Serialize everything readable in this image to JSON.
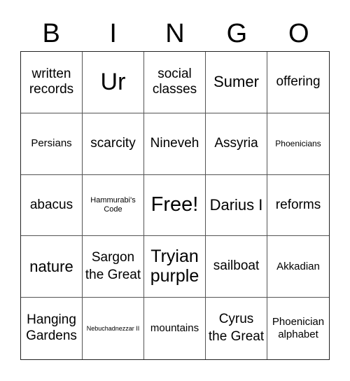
{
  "header": {
    "letters": [
      "B",
      "I",
      "N",
      "G",
      "O"
    ]
  },
  "grid": {
    "rows": [
      [
        "written records",
        "Ur",
        "social classes",
        "Sumer",
        "offering"
      ],
      [
        "Persians",
        "scarcity",
        "Nineveh",
        "Assyria",
        "Phoenicians"
      ],
      [
        "abacus",
        "Hammurabi's Code",
        "Free!",
        "Darius I",
        "reforms"
      ],
      [
        "nature",
        "Sargon the Great",
        "Tryian purple",
        "sailboat",
        "Akkadian"
      ],
      [
        "Hanging Gardens",
        "Nebuchadnezzar II",
        "mountains",
        "Cyrus the Great",
        "Phoenician alphabet"
      ]
    ]
  }
}
